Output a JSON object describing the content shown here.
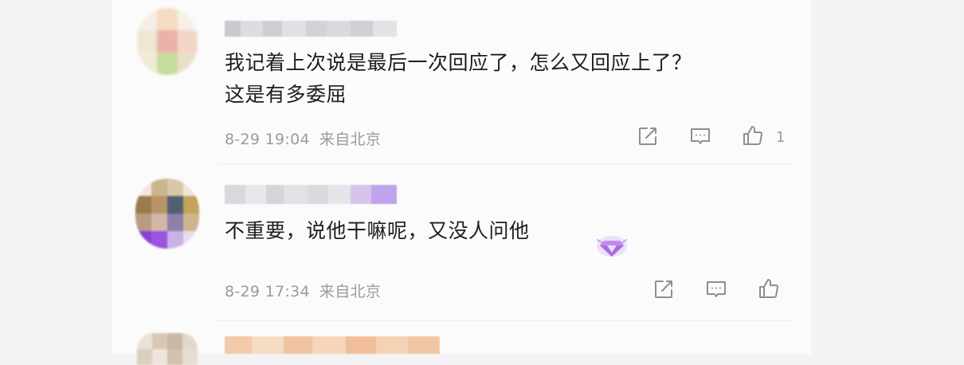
{
  "colors": {
    "text": "#1e1e22",
    "meta": "#9a9aa1",
    "icon": "#8e8e95",
    "badge": "#a86be0"
  },
  "comments": [
    {
      "text_line1": "我记着上次说是最后一次回应了，怎么又回应上了？",
      "text_line2": "这是有多委屈",
      "time": "8-29 19:04",
      "location": "来自北京",
      "like_count": "1",
      "icons": [
        "share-icon",
        "reply-icon",
        "like-icon"
      ]
    },
    {
      "text_line1": "不重要，说他干嘛呢，又没人问他",
      "time": "8-29 17:34",
      "location": "来自北京",
      "like_count": "",
      "icons": [
        "share-icon",
        "reply-icon",
        "like-icon",
        "diamond-badge-icon"
      ]
    }
  ]
}
